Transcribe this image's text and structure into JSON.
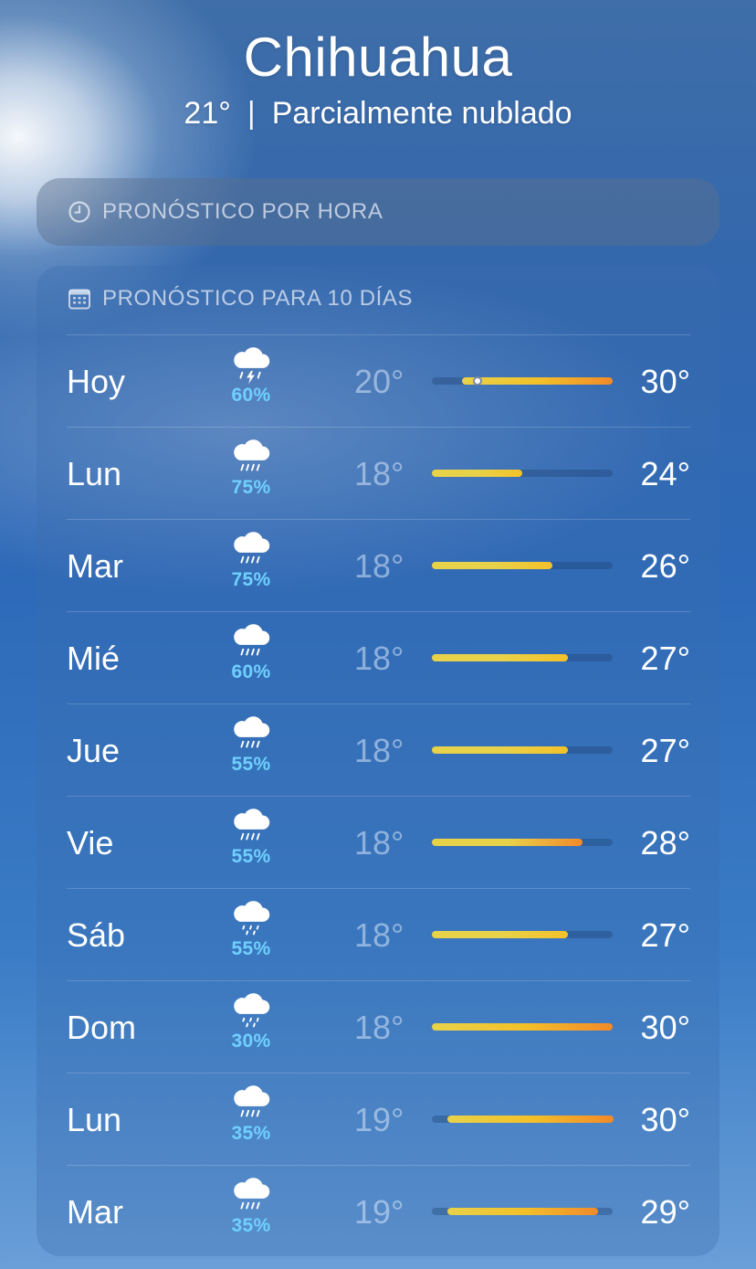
{
  "header": {
    "city": "Chihuahua",
    "current_temp": "21°",
    "separator": "|",
    "condition": "Parcialmente nublado"
  },
  "hourly": {
    "title": "PRONÓSTICO POR HORA",
    "icon": "clock-icon"
  },
  "daily": {
    "title": "PRONÓSTICO PARA 10 DÍAS",
    "icon": "calendar-icon",
    "range_min": 18,
    "range_max": 30,
    "days": [
      {
        "day": "Hoy",
        "icon": "thunderstorm-icon",
        "precip": "60%",
        "low": "20°",
        "high": "30°",
        "low_v": 20,
        "high_v": 30,
        "current_v": 21
      },
      {
        "day": "Lun",
        "icon": "rain-cloud-icon",
        "precip": "75%",
        "low": "18°",
        "high": "24°",
        "low_v": 18,
        "high_v": 24
      },
      {
        "day": "Mar",
        "icon": "rain-cloud-icon",
        "precip": "75%",
        "low": "18°",
        "high": "26°",
        "low_v": 18,
        "high_v": 26
      },
      {
        "day": "Mié",
        "icon": "rain-cloud-icon",
        "precip": "60%",
        "low": "18°",
        "high": "27°",
        "low_v": 18,
        "high_v": 27
      },
      {
        "day": "Jue",
        "icon": "rain-cloud-icon",
        "precip": "55%",
        "low": "18°",
        "high": "27°",
        "low_v": 18,
        "high_v": 27
      },
      {
        "day": "Vie",
        "icon": "rain-cloud-icon",
        "precip": "55%",
        "low": "18°",
        "high": "28°",
        "low_v": 18,
        "high_v": 28
      },
      {
        "day": "Sáb",
        "icon": "drizzle-cloud-icon",
        "precip": "55%",
        "low": "18°",
        "high": "27°",
        "low_v": 18,
        "high_v": 27
      },
      {
        "day": "Dom",
        "icon": "drizzle-cloud-icon",
        "precip": "30%",
        "low": "18°",
        "high": "30°",
        "low_v": 18,
        "high_v": 30
      },
      {
        "day": "Lun",
        "icon": "rain-cloud-icon",
        "precip": "35%",
        "low": "19°",
        "high": "30°",
        "low_v": 19,
        "high_v": 30
      },
      {
        "day": "Mar",
        "icon": "rain-cloud-icon",
        "precip": "35%",
        "low": "19°",
        "high": "29°",
        "low_v": 19,
        "high_v": 29
      }
    ]
  },
  "colors": {
    "precip": "#6fd0ff",
    "bar_cool": "#e8d24a",
    "bar_mid": "#f3c12a",
    "bar_warm": "#f28a2a"
  }
}
